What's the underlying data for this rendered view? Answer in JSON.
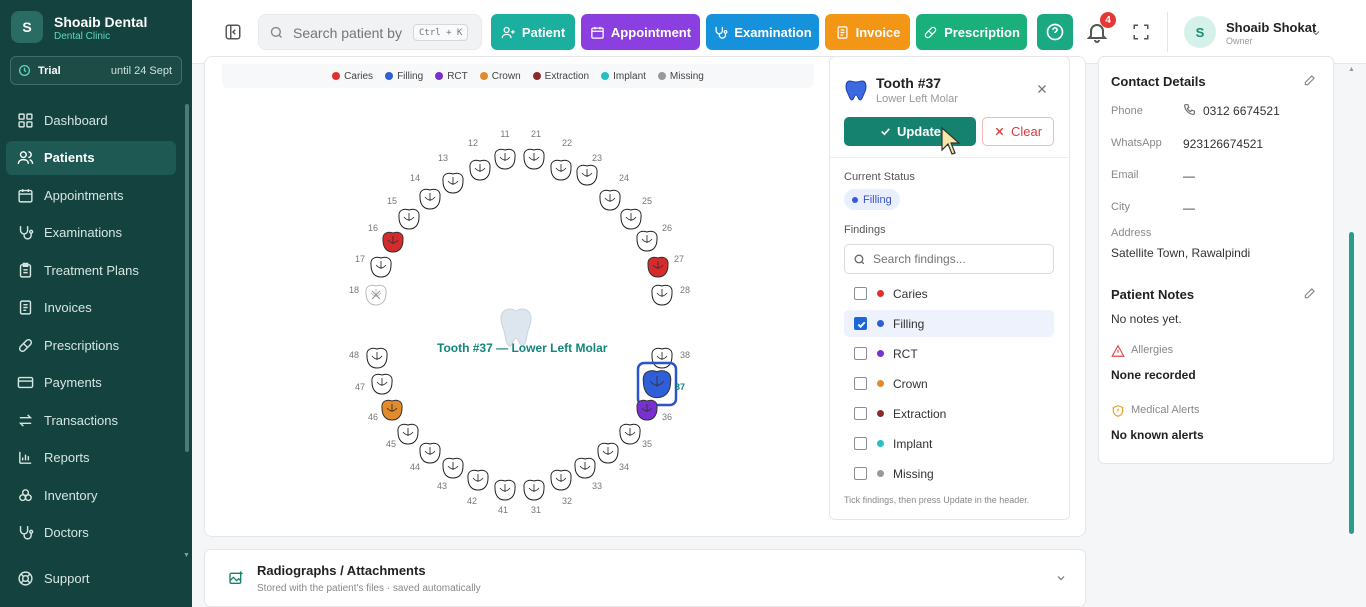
{
  "brand": {
    "logo_letter": "S",
    "name": "Shoaib Dental",
    "sub": "Dental Clinic"
  },
  "trial": {
    "label": "Trial",
    "until": "until 24 Sept"
  },
  "nav": [
    {
      "label": "Dashboard",
      "icon": "grid-icon",
      "active": false
    },
    {
      "label": "Patients",
      "icon": "users-icon",
      "active": true
    },
    {
      "label": "Appointments",
      "icon": "calendar-icon",
      "active": false
    },
    {
      "label": "Examinations",
      "icon": "stethoscope-icon",
      "active": false
    },
    {
      "label": "Treatment Plans",
      "icon": "clipboard-icon",
      "active": false
    },
    {
      "label": "Invoices",
      "icon": "invoice-icon",
      "active": false
    },
    {
      "label": "Prescriptions",
      "icon": "pill-icon",
      "active": false
    },
    {
      "label": "Payments",
      "icon": "card-icon",
      "active": false
    },
    {
      "label": "Transactions",
      "icon": "transfer-icon",
      "active": false
    },
    {
      "label": "Reports",
      "icon": "chart-icon",
      "active": false
    },
    {
      "label": "Inventory",
      "icon": "boxes-icon",
      "active": false
    },
    {
      "label": "Doctors",
      "icon": "stethoscope-icon",
      "active": false
    }
  ],
  "support": {
    "label": "Support"
  },
  "search": {
    "placeholder": "Search patient by n",
    "shortcut": "Ctrl + K"
  },
  "quick_actions": [
    {
      "label": "Patient",
      "color": "#1aaf9e"
    },
    {
      "label": "Appointment",
      "color": "#8b3fe0"
    },
    {
      "label": "Examination",
      "color": "#1692dd"
    },
    {
      "label": "Invoice",
      "color": "#f39515"
    },
    {
      "label": "Prescription",
      "color": "#19b07c"
    }
  ],
  "notifications": {
    "count": "4"
  },
  "user": {
    "avatar": "S",
    "name": "Shoaib Shokat",
    "role": "Owner"
  },
  "legend": [
    {
      "label": "Caries",
      "color": "#e0302e"
    },
    {
      "label": "Filling",
      "color": "#2f5fd8"
    },
    {
      "label": "RCT",
      "color": "#7a30d0"
    },
    {
      "label": "Crown",
      "color": "#e38a2a"
    },
    {
      "label": "Extraction",
      "color": "#8a2a2a"
    },
    {
      "label": "Implant",
      "color": "#22c1c8"
    },
    {
      "label": "Missing",
      "color": "#999999"
    }
  ],
  "teeth": [
    {
      "n": "11"
    },
    {
      "n": "21"
    },
    {
      "n": "12"
    },
    {
      "n": "22"
    },
    {
      "n": "13"
    },
    {
      "n": "23"
    },
    {
      "n": "14"
    },
    {
      "n": "24"
    },
    {
      "n": "15"
    },
    {
      "n": "25"
    },
    {
      "n": "16"
    },
    {
      "n": "26"
    },
    {
      "n": "17"
    },
    {
      "n": "27"
    },
    {
      "n": "18"
    },
    {
      "n": "28"
    },
    {
      "n": "48"
    },
    {
      "n": "38"
    },
    {
      "n": "47"
    },
    {
      "n": "37"
    },
    {
      "n": "46"
    },
    {
      "n": "36"
    },
    {
      "n": "45"
    },
    {
      "n": "35"
    },
    {
      "n": "44"
    },
    {
      "n": "34"
    },
    {
      "n": "43"
    },
    {
      "n": "33"
    },
    {
      "n": "42"
    },
    {
      "n": "32"
    },
    {
      "n": "41"
    },
    {
      "n": "31"
    }
  ],
  "tooth_status": {
    "16": "caries",
    "27": "caries",
    "46": "crown",
    "36": "rct",
    "37": "filling",
    "18": "missing"
  },
  "selected_label": "Tooth #37 — Lower Left Molar",
  "detail": {
    "title": "Tooth #37",
    "subtitle": "Lower Left Molar",
    "update_label": "Update",
    "clear_label": "Clear",
    "current_status_label": "Current Status",
    "current_status": "Filling",
    "findings_label": "Findings",
    "findings_placeholder": "Search findings...",
    "findings": [
      {
        "label": "Caries",
        "color": "#e0302e",
        "checked": false
      },
      {
        "label": "Filling",
        "color": "#2f5fd8",
        "checked": true
      },
      {
        "label": "RCT",
        "color": "#7a30d0",
        "checked": false
      },
      {
        "label": "Crown",
        "color": "#e38a2a",
        "checked": false
      },
      {
        "label": "Extraction",
        "color": "#8a2a2a",
        "checked": false
      },
      {
        "label": "Implant",
        "color": "#22c1c8",
        "checked": false
      },
      {
        "label": "Missing",
        "color": "#999999",
        "checked": false
      }
    ],
    "hint": "Tick findings, then press Update in the header."
  },
  "contact": {
    "title": "Contact Details",
    "phone_label": "Phone",
    "phone": "0312 6674521",
    "whatsapp_label": "WhatsApp",
    "whatsapp": "923126674521",
    "email_label": "Email",
    "email": "—",
    "city_label": "City",
    "city": "—",
    "address_label": "Address",
    "address": "Satellite Town, Rawalpindi"
  },
  "notes": {
    "title": "Patient Notes",
    "text": "No notes yet.",
    "allergies_label": "Allergies",
    "allergies": "None recorded",
    "alerts_label": "Medical Alerts",
    "alerts": "No known alerts"
  },
  "radiographs": {
    "title": "Radiographs / Attachments",
    "subtitle": "Stored with the patient's files · saved automatically"
  }
}
